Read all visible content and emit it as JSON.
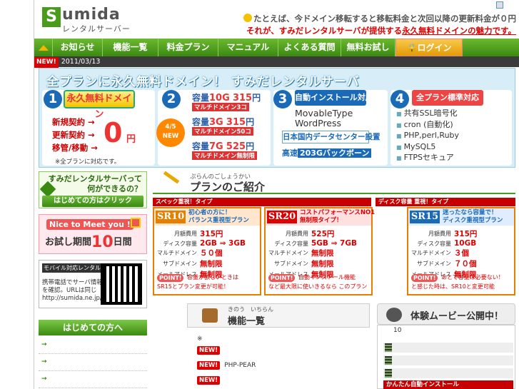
{
  "header": {
    "logo_letter": "S",
    "logo_word": "umida",
    "logo_sub": "レンタルサーバー",
    "tagline_line1": "たとえば、今ドメイン移転すると移転料金と次回以降の更新料金が０円",
    "tagline_line2_a": "それが、すみだレンタルサーバが提供する",
    "tagline_line2_b": "永久無料ドメインの魅力です。"
  },
  "nav": {
    "items": [
      "お知らせ",
      "機能一覧",
      "料金プラン",
      "マニュアル",
      "よくある質問",
      "無料お試し",
      "ログイン"
    ]
  },
  "news": {
    "badge": "NEW!",
    "date": "2011/03/13"
  },
  "banner": {
    "title": "全プランに永久無料ドメイン！ すみだレンタルサーバ",
    "col1": {
      "num": "1",
      "tag": "永久無料ドメイン",
      "rows": [
        "新規契約 →",
        "更新契約 →",
        "移管/移動 →"
      ],
      "zero": "0",
      "yen": "円",
      "note": "※全プランに対応です。"
    },
    "col2": {
      "num": "2",
      "badge": "4/5 NEW",
      "rows": [
        {
          "cap": "容量",
          "size": "10G",
          "price": "315",
          "unit": "円",
          "sub": "マルチドメイン3コ"
        },
        {
          "cap": "容量",
          "size": "3G",
          "price": "315",
          "unit": "円",
          "sub": "マルチドメイン50コ"
        },
        {
          "cap": "容量",
          "size": "7G",
          "price": "525",
          "unit": "円",
          "sub": "マルチドメイン無制限"
        }
      ]
    },
    "col3": {
      "num": "3",
      "tag": "自動インストール対応",
      "apps": [
        "MovableType",
        "WordPress"
      ],
      "dc": "日本国内データセンター設置",
      "bb_a": "高速",
      "bb_b": "203Gバックボーン"
    },
    "col4": {
      "num": "4",
      "tag": "全プラン標準対応",
      "items": [
        "共有SSL暗号化",
        "cron (自動化)",
        "PHP,perl,Ruby",
        "MySQL5",
        "FTPSセキュア"
      ]
    }
  },
  "left": {
    "what_line1": "すみだレンタルサーバって",
    "what_line2": "何ができるの？",
    "what_btn": "はじめての方はクリック",
    "trial_tag": "Nice to Meet you !",
    "trial_a": "お試し期間",
    "trial_b": "10",
    "trial_c": "日間",
    "mobile_tag": "モバイル対応レンタルサーバ",
    "mobile_desc1": "携帯電話でサーバ情報",
    "mobile_desc2": "を確認。URLは同じ",
    "mobile_url": "http://sumida.ne.jp/",
    "beginner": "はじめての方へ",
    "arrow": "→"
  },
  "plans": {
    "kana": "ぷらんのごしょうかい",
    "title": "プランのご紹介",
    "bands": [
      "スペック重視！タイプ",
      "ディスク容量 重視！タイプ"
    ],
    "keys": [
      "月額費用",
      "ディスク容量",
      "マルチドメイン",
      "サブドメイン",
      "メールアドレス"
    ],
    "list": [
      {
        "code": "SR10",
        "cat1": "初心者の方に！",
        "cat2": "バランス重視型プラン",
        "vals": [
          "315円",
          "2GB ⇒ 3GB",
          "５０個",
          "無制限",
          "無制限"
        ],
        "point": "POINT!",
        "note1": "容量が欲しいときは",
        "note2": "SR15とプラン変更が可能！"
      },
      {
        "code": "SR20",
        "cat1": "コストパフォーマンスNO1",
        "cat2": "無制限タイプ！",
        "vals": [
          "525円",
          "5GB ⇒ 7GB",
          "無制限",
          "無制限",
          "無制限"
        ],
        "point": "POINT!",
        "note1": "自動インストール機能",
        "note2": "など最大限に使いきるなら このプラン"
      },
      {
        "code": "SR15",
        "cat1": "迷ったなら容量で！",
        "cat2": "ディスク重視型プラン",
        "vals": [
          "315円",
          "10GB",
          "３個",
          "７０個",
          "無制限"
        ],
        "point": "POINT!",
        "note1": "あとで容量は必要ない！",
        "note2": "と感じた時は、SR10と変更可能"
      }
    ]
  },
  "features": {
    "kana": "きのう　いちらん",
    "title": "機能一覧",
    "mark": "※",
    "rows": [
      {
        "badge": "NEW!",
        "text": ""
      },
      {
        "badge": "NEW!",
        "text": "PHP-PEAR"
      },
      {
        "badge": "NEW!",
        "text": ""
      }
    ]
  },
  "movie": {
    "title": "体験ムービー公開中！",
    "num": "10",
    "caption": "かんたん自動インストール"
  },
  "colors": {
    "brand_green": "#4a9a1c",
    "accent_red": "#d00000",
    "accent_orange": "#e67e00",
    "blue": "#1a6ab8"
  }
}
